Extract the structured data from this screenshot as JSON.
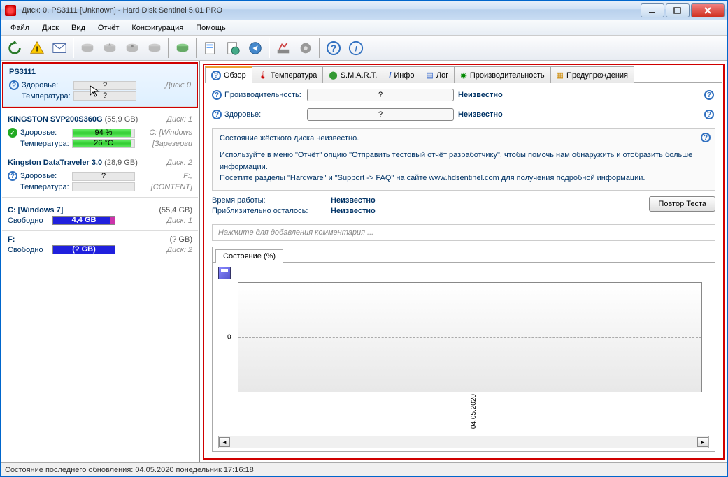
{
  "window": {
    "title": "Диск: 0, PS3111 [Unknown]   -   Hard Disk Sentinel 5.01 PRO"
  },
  "menu": {
    "file": "Файл",
    "disk": "Диск",
    "view": "Вид",
    "report": "Отчёт",
    "config": "Конфигурация",
    "help": "Помощь"
  },
  "sidebar": {
    "disks": [
      {
        "name": "PS3111",
        "cap": "",
        "dn": "",
        "health_lbl": "Здоровье:",
        "health": "?",
        "hr": "Диск: 0",
        "temp_lbl": "Температура:",
        "temp": "?",
        "tr": "",
        "sel": true,
        "ok": false
      },
      {
        "name": "KINGSTON SVP200S360G",
        "cap": "(55,9 GB)",
        "dn": "Диск: 1",
        "health_lbl": "Здоровье:",
        "health": "94 %",
        "hr": "C: [Windows",
        "temp_lbl": "Температура:",
        "temp": "26 °C",
        "tr": "[Зарезерви",
        "sel": false,
        "ok": true
      },
      {
        "name": "Kingston DataTraveler 3.0",
        "cap": "(28,9 GB)",
        "dn": "Диск: 2",
        "health_lbl": "Здоровье:",
        "health": "?",
        "hr": "F:,",
        "temp_lbl": "Температура:",
        "temp": "",
        "tr": "[CONTENT]",
        "sel": false,
        "ok": false
      }
    ],
    "vols": [
      {
        "name": "C: [Windows 7]",
        "cap": "(55,4 GB)",
        "free_lbl": "Свободно",
        "free": "4,4 GB",
        "dn": "Диск: 1",
        "mag": true
      },
      {
        "name": "F:",
        "cap": "(? GB)",
        "free_lbl": "Свободно",
        "free": "(? GB)",
        "dn": "Диск: 2",
        "mag": false
      }
    ]
  },
  "tabs": {
    "overview": "Обзор",
    "temp": "Температура",
    "smart": "S.M.A.R.T.",
    "info": "Инфо",
    "log": "Лог",
    "perf": "Производительность",
    "alert": "Предупреждения"
  },
  "metrics": {
    "perf_lbl": "Производительность:",
    "perf_val": "?",
    "perf_txt": "Неизвестно",
    "health_lbl": "Здоровье:",
    "health_val": "?",
    "health_txt": "Неизвестно"
  },
  "status": {
    "head": "Состояние жёсткого диска неизвестно.",
    "body1": "Используйте в меню \"Отчёт\" опцию \"Отправить тестовый отчёт разработчику\", чтобы помочь нам обнаружить и отобразить больше информации.",
    "body2": "Посетите разделы \"Hardware\" и \"Support -> FAQ\" на сайте www.hdsentinel.com для получения подробной информации."
  },
  "time": {
    "uptime_lbl": "Время работы:",
    "uptime_val": "Неизвестно",
    "remain_lbl": "Приблизительно осталось:",
    "remain_val": "Неизвестно",
    "retest": "Повтор Теста"
  },
  "comment": {
    "placeholder": "Нажмите для добавления комментария ..."
  },
  "chart": {
    "tab": "Состояние (%)",
    "ytick": "0",
    "xdate": "04.05.2020"
  },
  "chart_data": {
    "type": "line",
    "title": "Состояние (%)",
    "x": [
      "04.05.2020"
    ],
    "values": [
      null
    ],
    "ylim": [
      0,
      100
    ],
    "ytick_visible": [
      0
    ]
  },
  "statusbar": {
    "text": "Состояние последнего обновления: 04.05.2020 понедельник 17:16:18"
  }
}
